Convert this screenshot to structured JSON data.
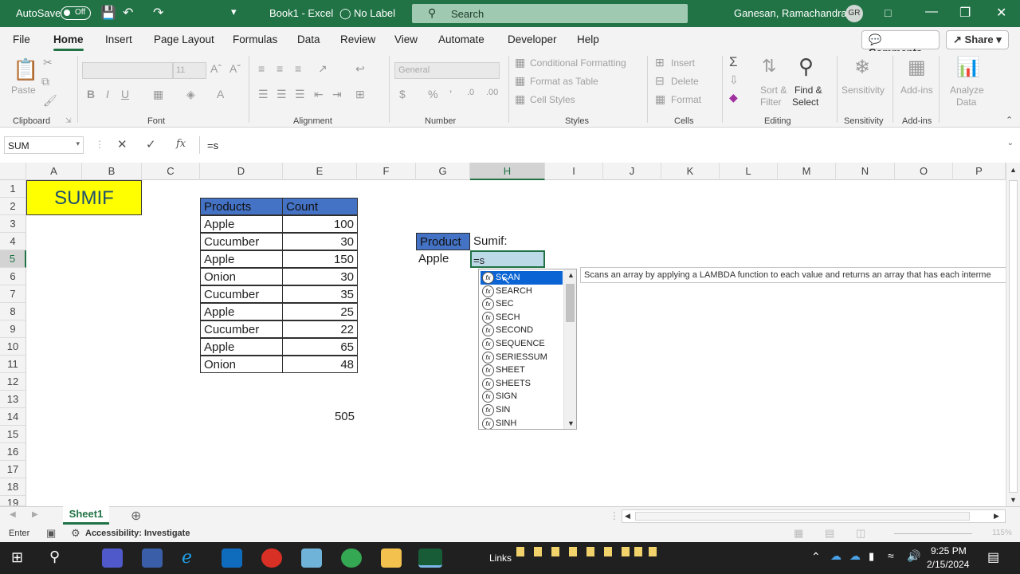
{
  "titlebar": {
    "autosave": "AutoSave",
    "autosave_state": "Off",
    "doc": "Book1  -  Excel",
    "label": "No Label",
    "search": "Search",
    "user": "Ganesan, Ramachandran",
    "initials": "GR"
  },
  "menu": [
    "File",
    "Home",
    "Insert",
    "Page Layout",
    "Formulas",
    "Data",
    "Review",
    "View",
    "Automate",
    "Developer",
    "Help"
  ],
  "menu_active": "Home",
  "topbuttons": {
    "comments": "Comments",
    "share": "Share"
  },
  "ribbon": {
    "groups": [
      "Clipboard",
      "Font",
      "Alignment",
      "Number",
      "Styles",
      "Cells",
      "Editing",
      "Sensitivity",
      "Add-ins"
    ],
    "paste": "Paste",
    "font_size": "11",
    "number_format": "General",
    "styles": [
      "Conditional Formatting",
      "Format as Table",
      "Cell Styles"
    ],
    "cells": [
      "Insert",
      "Delete",
      "Format"
    ],
    "sort": [
      "Sort &",
      "Filter"
    ],
    "find": [
      "Find &",
      "Select"
    ],
    "sensitivity": "Sensitivity",
    "addins": "Add-ins",
    "analyze": [
      "Analyze",
      "Data"
    ]
  },
  "formula_bar": {
    "name_box": "SUM",
    "formula": "=s"
  },
  "columns": [
    "A",
    "B",
    "C",
    "D",
    "E",
    "F",
    "G",
    "H",
    "I",
    "J",
    "K",
    "L",
    "M",
    "N",
    "O",
    "P"
  ],
  "selected_column": "H",
  "rows": [
    "1",
    "2",
    "3",
    "4",
    "5",
    "6",
    "7",
    "8",
    "9",
    "10",
    "11",
    "12",
    "13",
    "14",
    "15",
    "16",
    "17",
    "18",
    "19"
  ],
  "selected_row": "5",
  "sheet": {
    "title": "SUMIF",
    "table_headers": [
      "Products",
      "Count"
    ],
    "table_rows": [
      [
        "Apple",
        "100"
      ],
      [
        "Cucumber",
        "30"
      ],
      [
        "Apple",
        "150"
      ],
      [
        "Onion",
        "30"
      ],
      [
        "Cucumber",
        "35"
      ],
      [
        "Apple",
        "25"
      ],
      [
        "Cucumber",
        "22"
      ],
      [
        "Apple",
        "65"
      ],
      [
        "Onion",
        "48"
      ]
    ],
    "total": "505",
    "product_label": "Product",
    "sumif_label": "Sumif:",
    "product_value": "Apple",
    "active_cell": "=s"
  },
  "autocomplete": {
    "items": [
      "SCAN",
      "SEARCH",
      "SEC",
      "SECH",
      "SECOND",
      "SEQUENCE",
      "SERIESSUM",
      "SHEET",
      "SHEETS",
      "SIGN",
      "SIN",
      "SINH"
    ],
    "tooltip": "Scans an array by applying a LAMBDA function to each value and returns an array that has each interme"
  },
  "sheet_tab": "Sheet1",
  "status": {
    "mode": "Enter",
    "accessibility": "Accessibility: Investigate",
    "zoom": "115%"
  },
  "taskbar": {
    "links": "Links",
    "time": "9:25 PM",
    "date": "2/15/2024"
  },
  "colors": {
    "excel_green": "#217346",
    "title_yellow": "#ffff00",
    "header_blue": "#4472c4",
    "selection_blue": "#0a64d3"
  }
}
